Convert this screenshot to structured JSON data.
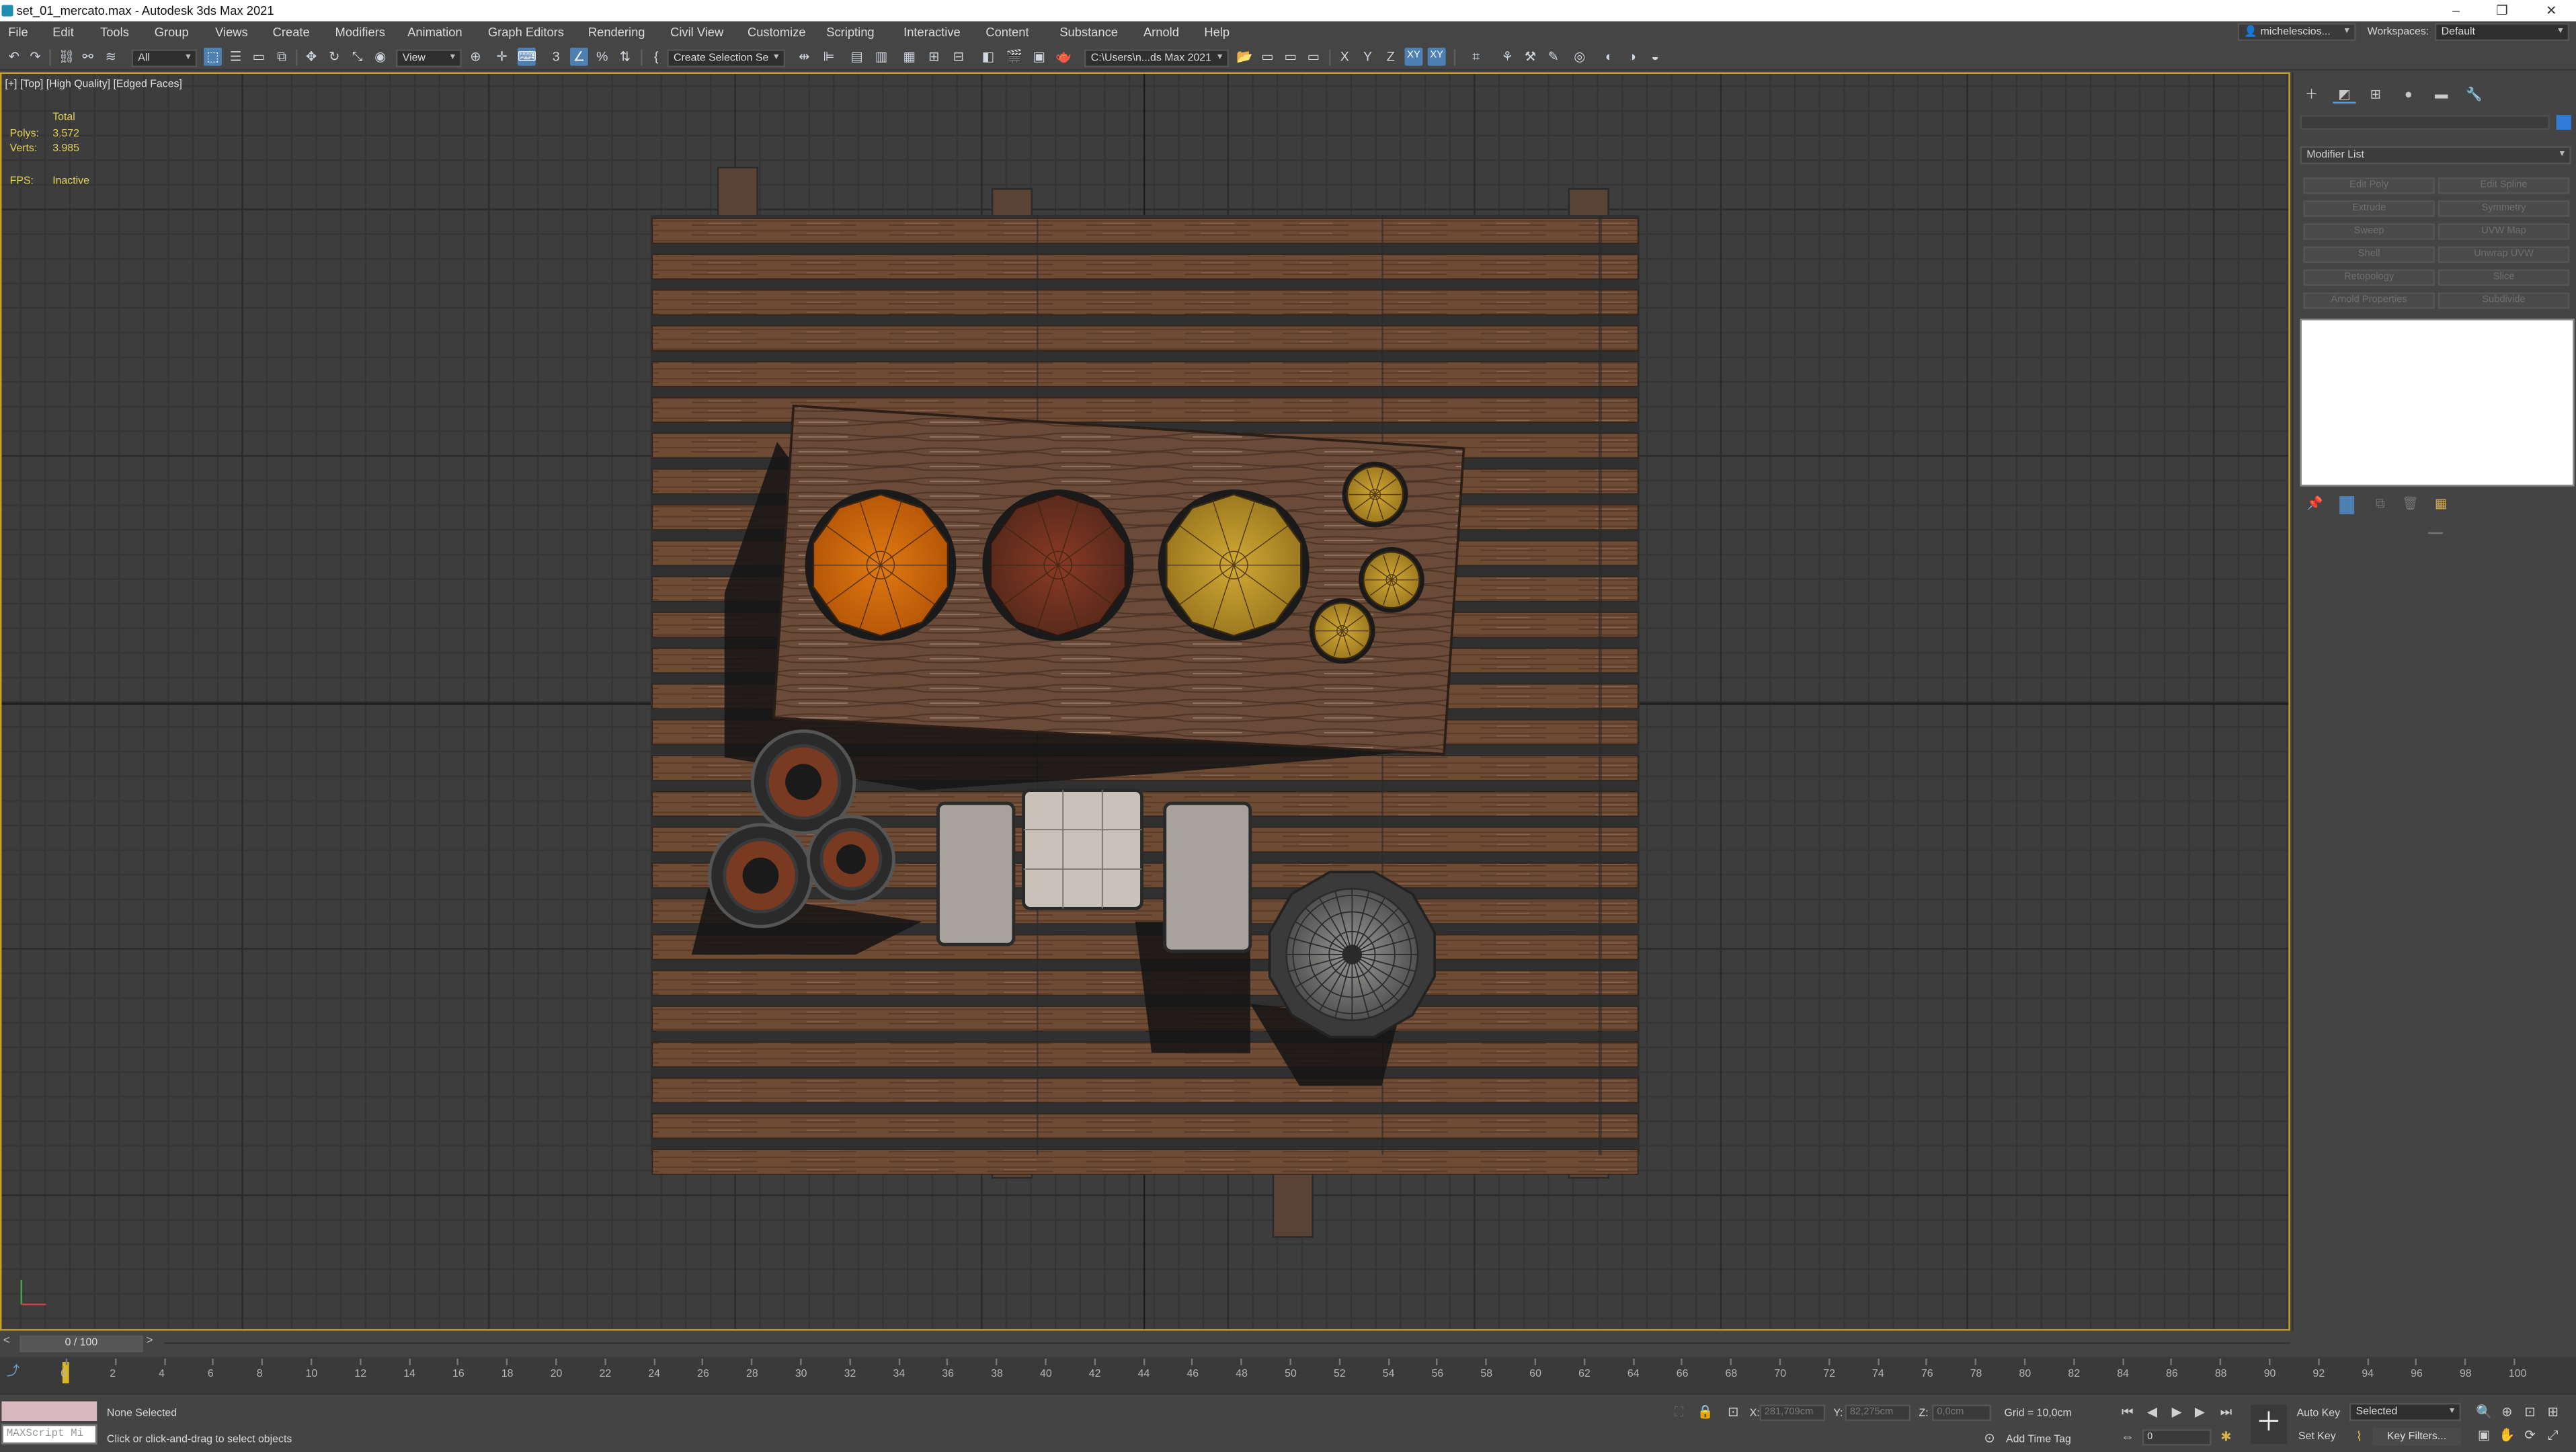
{
  "window": {
    "title": "set_01_mercato.max - Autodesk 3ds Max 2021"
  },
  "menu": [
    "File",
    "Edit",
    "Tools",
    "Group",
    "Views",
    "Create",
    "Modifiers",
    "Animation",
    "Graph Editors",
    "Rendering",
    "Civil View",
    "Customize",
    "Scripting",
    "Interactive",
    "Content",
    "Substance",
    "Arnold",
    "Help"
  ],
  "account": {
    "user": "michelescios...",
    "workspaces_label": "Workspaces:",
    "workspace": "Default"
  },
  "toolbar": {
    "filter_select": "All",
    "ref_coord_select": "View",
    "named_selection": "Create Selection Se",
    "project_path": "C:\\Users\\n...ds Max 2021",
    "axis_x": "X",
    "axis_y": "Y",
    "axis_z": "Z",
    "axis_xy": "XY",
    "axis_constraint": "XY"
  },
  "viewport": {
    "label": "[+] [Top] [High Quality] [Edged Faces]",
    "stats_header": "Total",
    "polys_label": "Polys:",
    "polys_value": "3.572",
    "verts_label": "Verts:",
    "verts_value": "3.985",
    "fps_label": "FPS:",
    "fps_value": "Inactive"
  },
  "command_panel": {
    "modifier_list": "Modifier List",
    "modifiers": [
      "Edit Poly",
      "Edit Spline",
      "Extrude",
      "Symmetry",
      "Sweep",
      "UVW Map",
      "Shell",
      "Unwrap UVW",
      "Retopology",
      "Slice",
      "Arnold Properties",
      "Subdivide"
    ]
  },
  "timeline": {
    "frame_display": "0 / 100",
    "prev": "<",
    "next": ">",
    "ticks": [
      "0",
      "2",
      "4",
      "6",
      "8",
      "10",
      "12",
      "14",
      "16",
      "18",
      "20",
      "22",
      "24",
      "26",
      "28",
      "30",
      "32",
      "34",
      "36",
      "38",
      "40",
      "42",
      "44",
      "46",
      "48",
      "50",
      "52",
      "54",
      "56",
      "58",
      "60",
      "62",
      "64",
      "66",
      "68",
      "70",
      "72",
      "74",
      "76",
      "78",
      "80",
      "82",
      "84",
      "86",
      "88",
      "90",
      "92",
      "94",
      "96",
      "98",
      "100"
    ]
  },
  "status": {
    "selection": "None Selected",
    "prompt": "Click or click-and-drag to select objects",
    "maxscript": "MAXScript Mi",
    "x_label": "X:",
    "x_value": "281,709cm",
    "y_label": "Y:",
    "y_value": "82,275cm",
    "z_label": "Z:",
    "z_value": "0,0cm",
    "grid": "Grid = 10,0cm",
    "add_time_tag": "Add Time Tag",
    "auto_key": "Auto Key",
    "set_key": "Set Key",
    "key_mode": "Selected",
    "key_filters": "Key Filters...",
    "frame_field": "0"
  },
  "colors": {
    "accent": "#4f80b4",
    "viewport_border": "#c8a02c",
    "stats": "#e6d25a",
    "bg": "#444444"
  }
}
